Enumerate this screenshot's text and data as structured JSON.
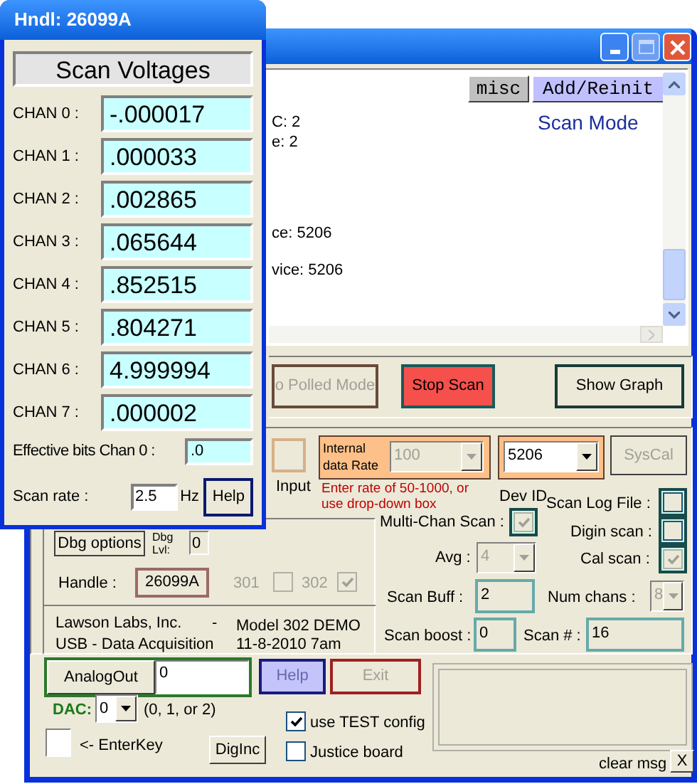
{
  "scan_window": {
    "title": "Hndl: 26099A",
    "heading": "Scan Voltages",
    "channels": [
      {
        "label": "CHAN 0 :",
        "value": "-.000017"
      },
      {
        "label": "CHAN 1 :",
        "value": ".000033"
      },
      {
        "label": "CHAN 2 :",
        "value": ".002865"
      },
      {
        "label": "CHAN 3 :",
        "value": ".065644"
      },
      {
        "label": "CHAN 4 :",
        "value": ".852515"
      },
      {
        "label": "CHAN 5 :",
        "value": ".804271"
      },
      {
        "label": "CHAN 6 :",
        "value": "4.999994"
      },
      {
        "label": "CHAN 7 :",
        "value": ".000002"
      }
    ],
    "effective_bits": {
      "label": "Effective bits  Chan 0 :",
      "value": ".0"
    },
    "scan_rate": {
      "label": "Scan rate :",
      "value": "2.5",
      "unit": "Hz"
    },
    "help_button": "Help"
  },
  "main_window": {
    "log": {
      "buttons": [
        {
          "label": "misc",
          "highlighted": false
        },
        {
          "label": "Add/Reinit",
          "highlighted": true
        }
      ],
      "mode": "Scan Mode",
      "lines": [
        "C: 2",
        "e: 2",
        "ce: 5206",
        "vice: 5206"
      ]
    },
    "mode_buttons": [
      {
        "label": "o Polled Mode",
        "kind": "plain",
        "disabled": true
      },
      {
        "label": "Stop Scan",
        "kind": "alert",
        "disabled": false
      },
      {
        "label": "Show Graph",
        "kind": "plain",
        "disabled": false
      }
    ],
    "input_label": "Input",
    "data_rate": {
      "label": "Internal data Rate",
      "value": "100",
      "disabled": true,
      "hint": "Enter rate of  50-1000, or use drop-down box"
    },
    "device": {
      "value": "5206",
      "label": "Dev ID"
    },
    "syscal_button": {
      "label": "SysCal",
      "disabled": true
    },
    "options": [
      {
        "label": "Scan Log File :",
        "checked": false,
        "disabled": false
      },
      {
        "label": "Multi-Chan Scan :",
        "checked": true,
        "disabled": true
      },
      {
        "label": "Digin scan :",
        "checked": false,
        "disabled": false
      },
      {
        "label": "Cal scan :",
        "checked": true,
        "disabled": true
      }
    ],
    "avg": {
      "label": "Avg :",
      "value": "4",
      "disabled": true
    },
    "scan_buff": {
      "label": "Scan  Buff :",
      "value": "2"
    },
    "num_chans": {
      "label": "Num chans :",
      "value": "8",
      "disabled": true
    },
    "scan_boost": {
      "label": "Scan boost :",
      "value": "0"
    },
    "scan_number": {
      "label": "Scan # :",
      "value": "16"
    },
    "debug": {
      "button": "Dbg options",
      "level_label": "Dbg Lvl:",
      "level_value": "0"
    },
    "handle": {
      "label": "Handle :",
      "value": "26099A"
    },
    "models": [
      {
        "label": "301",
        "checked": false,
        "disabled": true
      },
      {
        "label": "302",
        "checked": true,
        "disabled": true
      }
    ],
    "about": [
      "Lawson Labs, Inc.",
      "-",
      "Model 302 DEMO",
      "USB - Data Acquisition",
      "11-8-2010 7am"
    ],
    "analog_out": {
      "button": "AnalogOut",
      "value": "0"
    },
    "help_button": {
      "label": "Help",
      "disabled": true
    },
    "exit_button": {
      "label": "Exit",
      "disabled": true
    },
    "dac": {
      "label": "DAC:",
      "value": "0",
      "hint": "(0, 1, or 2)"
    },
    "enter_key": {
      "label": "<- EnterKey",
      "checked": false
    },
    "diginc_button": "DigInc",
    "configs": [
      {
        "label": "use TEST config",
        "checked": true
      },
      {
        "label": "Justice board",
        "checked": false
      }
    ],
    "clear_msg": {
      "label": "clear msg",
      "button": "X"
    }
  }
}
